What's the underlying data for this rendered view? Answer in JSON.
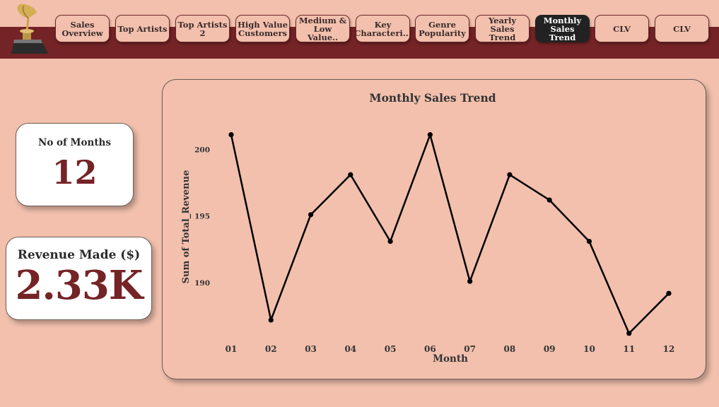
{
  "nav": {
    "items": [
      {
        "label": "Sales\nOverview",
        "active": false
      },
      {
        "label": "Top Artists",
        "active": false
      },
      {
        "label": "Top Artists 2",
        "active": false
      },
      {
        "label": "High Value\nCustomers",
        "active": false
      },
      {
        "label": "Medium &\nLow Value..",
        "active": false
      },
      {
        "label": "Key\nCharacteri...",
        "active": false
      },
      {
        "label": "Genre\nPopularity",
        "active": false
      },
      {
        "label": "Yearly Sales\nTrend",
        "active": false
      },
      {
        "label": "Monthly Sales\nTrend",
        "active": true
      },
      {
        "label": "CLV",
        "active": false
      },
      {
        "label": "CLV",
        "active": false
      }
    ]
  },
  "kpi": {
    "months_label": "No of Months",
    "months_value": "12",
    "revenue_label": "Revenue Made ($)",
    "revenue_value": "2.33K"
  },
  "colors": {
    "background": "#f2c0ad",
    "brand": "#742326",
    "active_tab": "#222222",
    "line": "#000000"
  },
  "chart_data": {
    "type": "line",
    "title": "Monthly Sales Trend",
    "xlabel": "Month",
    "ylabel": "Sum of Total_Revenue",
    "categories": [
      "01",
      "02",
      "03",
      "04",
      "05",
      "06",
      "07",
      "08",
      "09",
      "10",
      "11",
      "12"
    ],
    "series": [
      {
        "values": [
          201.1,
          187.2,
          195.1,
          198.1,
          193.1,
          201.1,
          190.1,
          198.1,
          196.2,
          193.1,
          186.2,
          189.2
        ]
      }
    ],
    "yticks": [
      190,
      195,
      200
    ],
    "ylim": [
      185.5,
      202.3
    ],
    "grid": false,
    "legend": "none"
  }
}
